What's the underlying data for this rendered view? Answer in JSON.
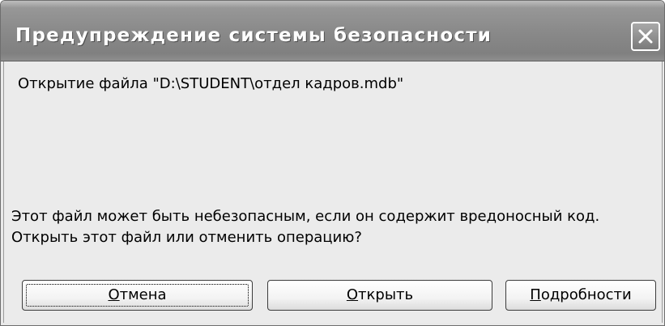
{
  "window": {
    "title": "Предупреждение системы безопасности"
  },
  "message": {
    "file_line": "Открытие файла \"D:\\STUDENT\\отдел кадров.mdb\"",
    "warning_line": "Этот файл может быть небезопасным, если он содержит вредоносный код.",
    "question_line": "Открыть этот файл или отменить операцию?"
  },
  "buttons": {
    "cancel": {
      "mnemonic": "О",
      "rest": "тмена"
    },
    "open": {
      "mnemonic": "О",
      "rest": "ткрыть"
    },
    "details": {
      "mnemonic": "П",
      "rest": "одробности"
    }
  },
  "icons": {
    "close": "close-icon"
  }
}
